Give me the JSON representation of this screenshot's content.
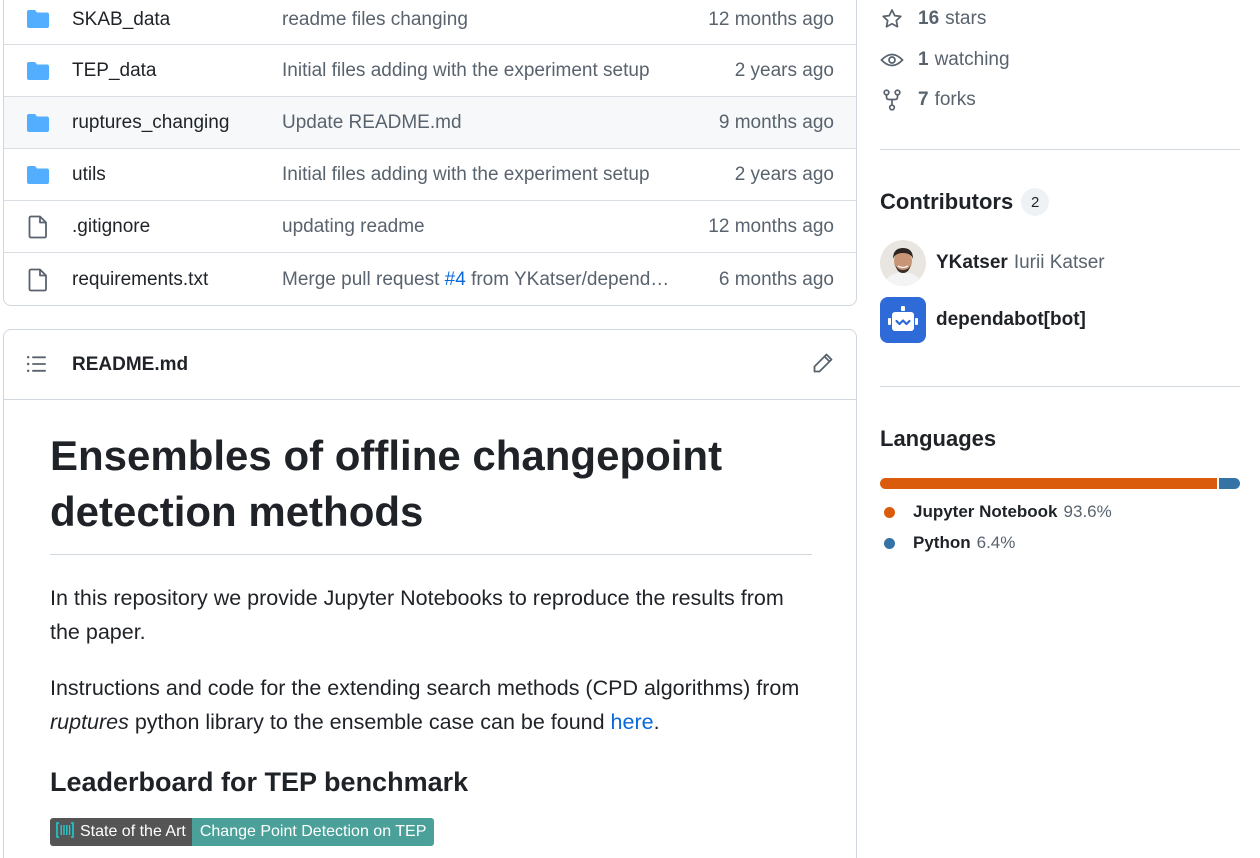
{
  "files": [
    {
      "name": "SKAB_data",
      "type": "folder",
      "message": "readme files changing",
      "age": "12 months ago"
    },
    {
      "name": "TEP_data",
      "type": "folder",
      "message": "Initial files adding with the experiment setup",
      "age": "2 years ago"
    },
    {
      "name": "ruptures_changing",
      "type": "folder",
      "message": "Update README.md",
      "age": "9 months ago"
    },
    {
      "name": "utils",
      "type": "folder",
      "message": "Initial files adding with the experiment setup",
      "age": "2 years ago"
    },
    {
      "name": ".gitignore",
      "type": "file",
      "message": "updating readme",
      "age": "12 months ago"
    },
    {
      "name": "requirements.txt",
      "type": "file",
      "message_prefix": "Merge pull request ",
      "message_issue": "#4",
      "message_suffix": " from YKatser/dependabot",
      "age": "6 months ago"
    }
  ],
  "readme": {
    "filename": "README.md",
    "h1": "Ensembles of offline changepoint detection methods",
    "p1": "In this repository we provide Jupyter Notebooks to reproduce the results from the paper.",
    "p2_before": "Instructions and code for the extending search methods (CPD algorithms) from ",
    "p2_em": "ruptures",
    "p2_middle": " python library to the ensemble case can be found ",
    "p2_link": "here",
    "p2_end": ".",
    "h2": "Leaderboard for TEP benchmark",
    "badge_left": "State of the Art",
    "badge_right": "Change Point Detection on TEP"
  },
  "sidebar": {
    "stars_count": "16",
    "stars_label": "stars",
    "watching_count": "1",
    "watching_label": "watching",
    "forks_count": "7",
    "forks_label": "forks",
    "contributors_title": "Contributors",
    "contributors_count": "2",
    "contributors": [
      {
        "login": "YKatser",
        "name": "Iurii Katser"
      },
      {
        "login": "dependabot[bot]",
        "name": ""
      }
    ],
    "languages_title": "Languages",
    "languages": [
      {
        "name": "Jupyter Notebook",
        "pct": "93.6%",
        "value": 93.6,
        "color": "#DA5B0B"
      },
      {
        "name": "Python",
        "pct": "6.4%",
        "value": 6.4,
        "color": "#3572A5"
      }
    ]
  }
}
